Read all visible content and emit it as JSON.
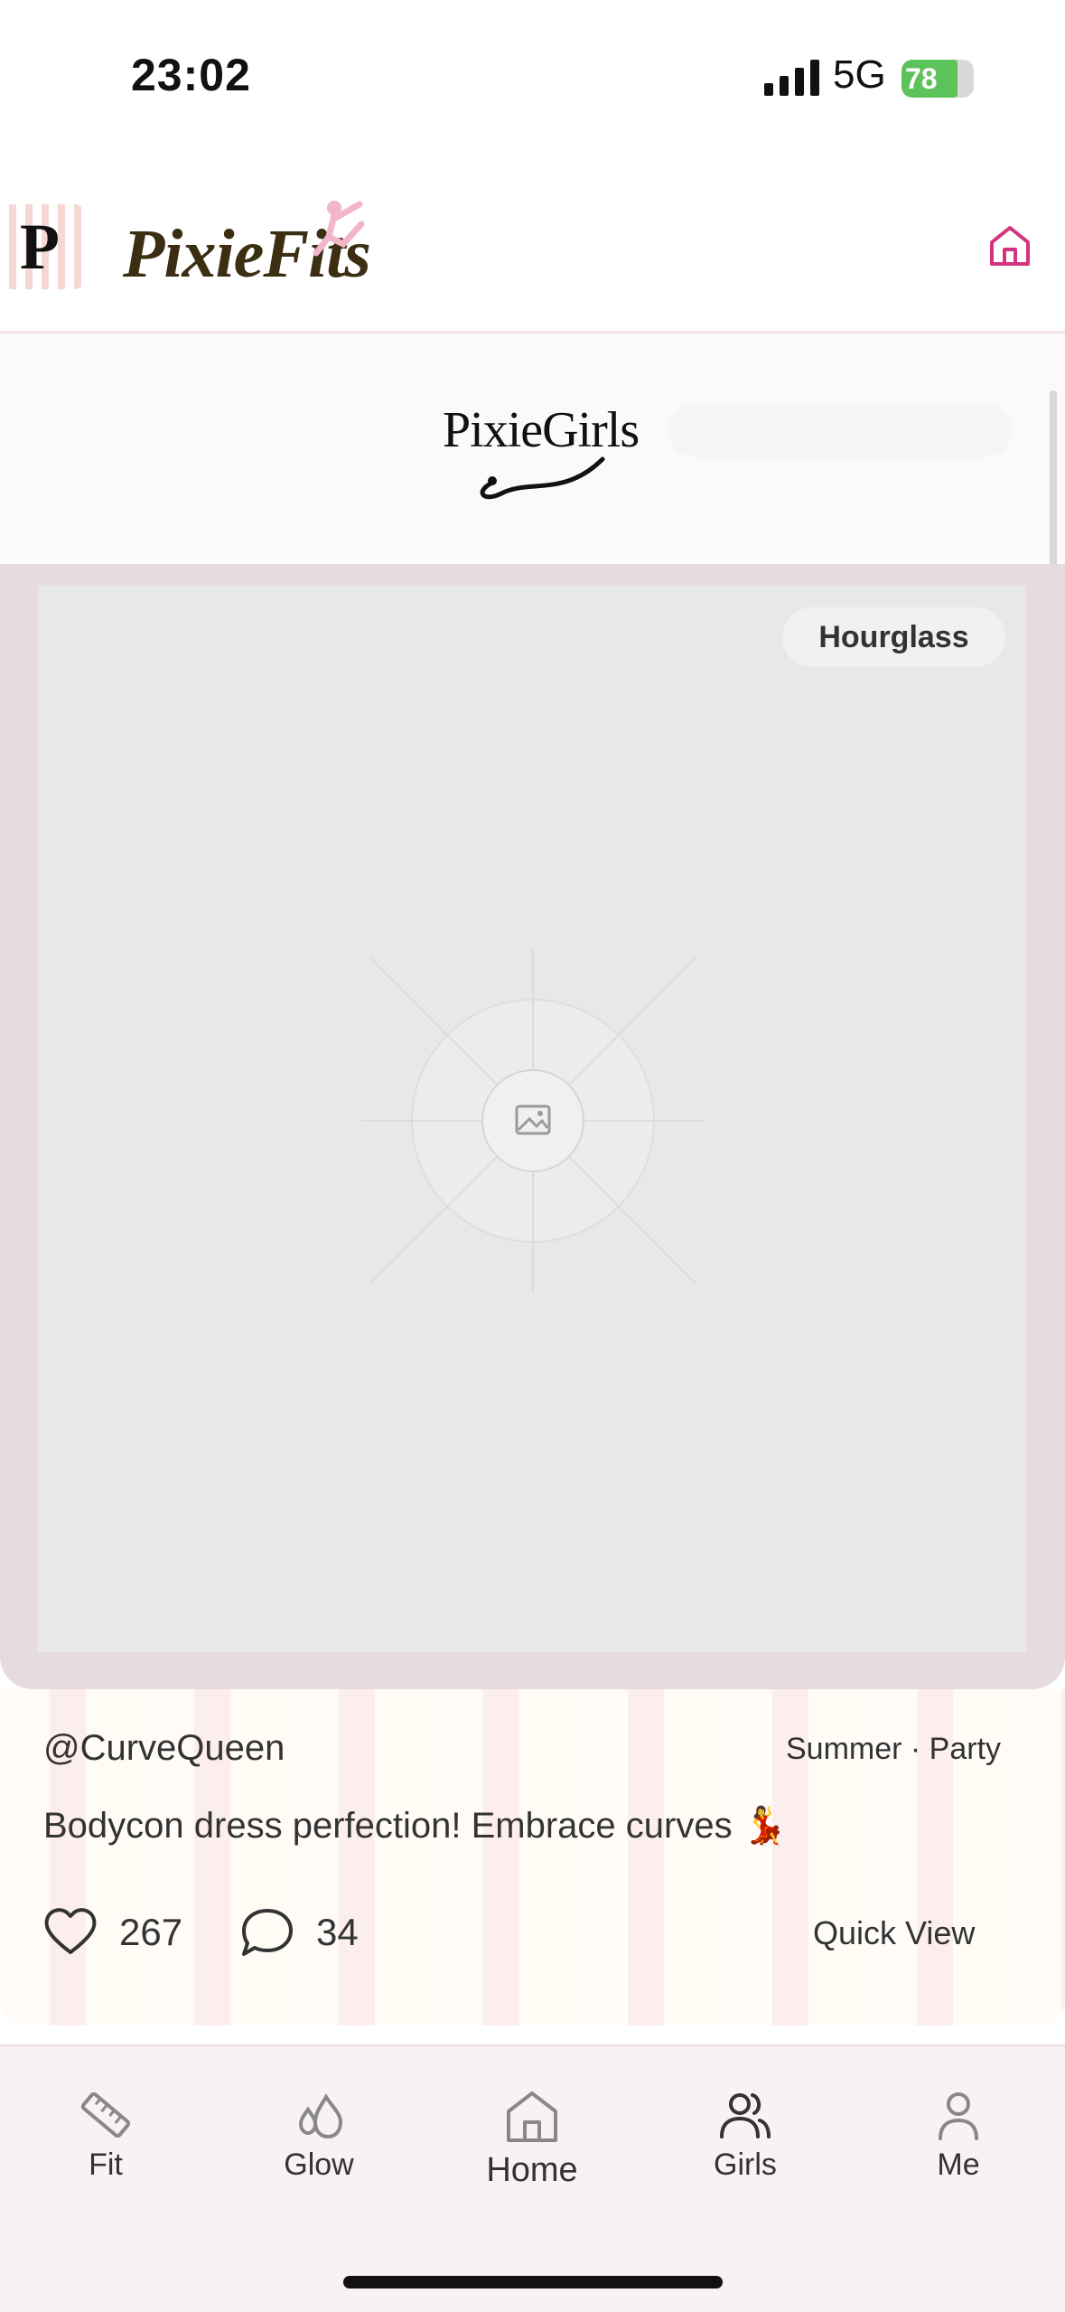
{
  "status_bar": {
    "time": "23:02",
    "network": "5G",
    "battery": "78",
    "battery_level": 0.78
  },
  "header": {
    "logo_letter": "P",
    "brand": "PixieFits",
    "home_icon": "home-icon"
  },
  "feed": {
    "section_logo": "PixieGirls",
    "accent_color": "#d6337f"
  },
  "post": {
    "body_type_tag": "Hourglass",
    "username": "@CurveQueen",
    "tags": "Summer · Party",
    "caption": "Bodycon dress perfection! Embrace curves 💃",
    "likes": "267",
    "comments": "34",
    "quick_view": "Quick View"
  },
  "tabbar": {
    "items": [
      {
        "label": "Fit",
        "icon": "ruler-icon"
      },
      {
        "label": "Glow",
        "icon": "droplets-icon"
      },
      {
        "label": "Home",
        "icon": "home-icon"
      },
      {
        "label": "Girls",
        "icon": "users-icon"
      },
      {
        "label": "Me",
        "icon": "user-icon"
      }
    ]
  }
}
